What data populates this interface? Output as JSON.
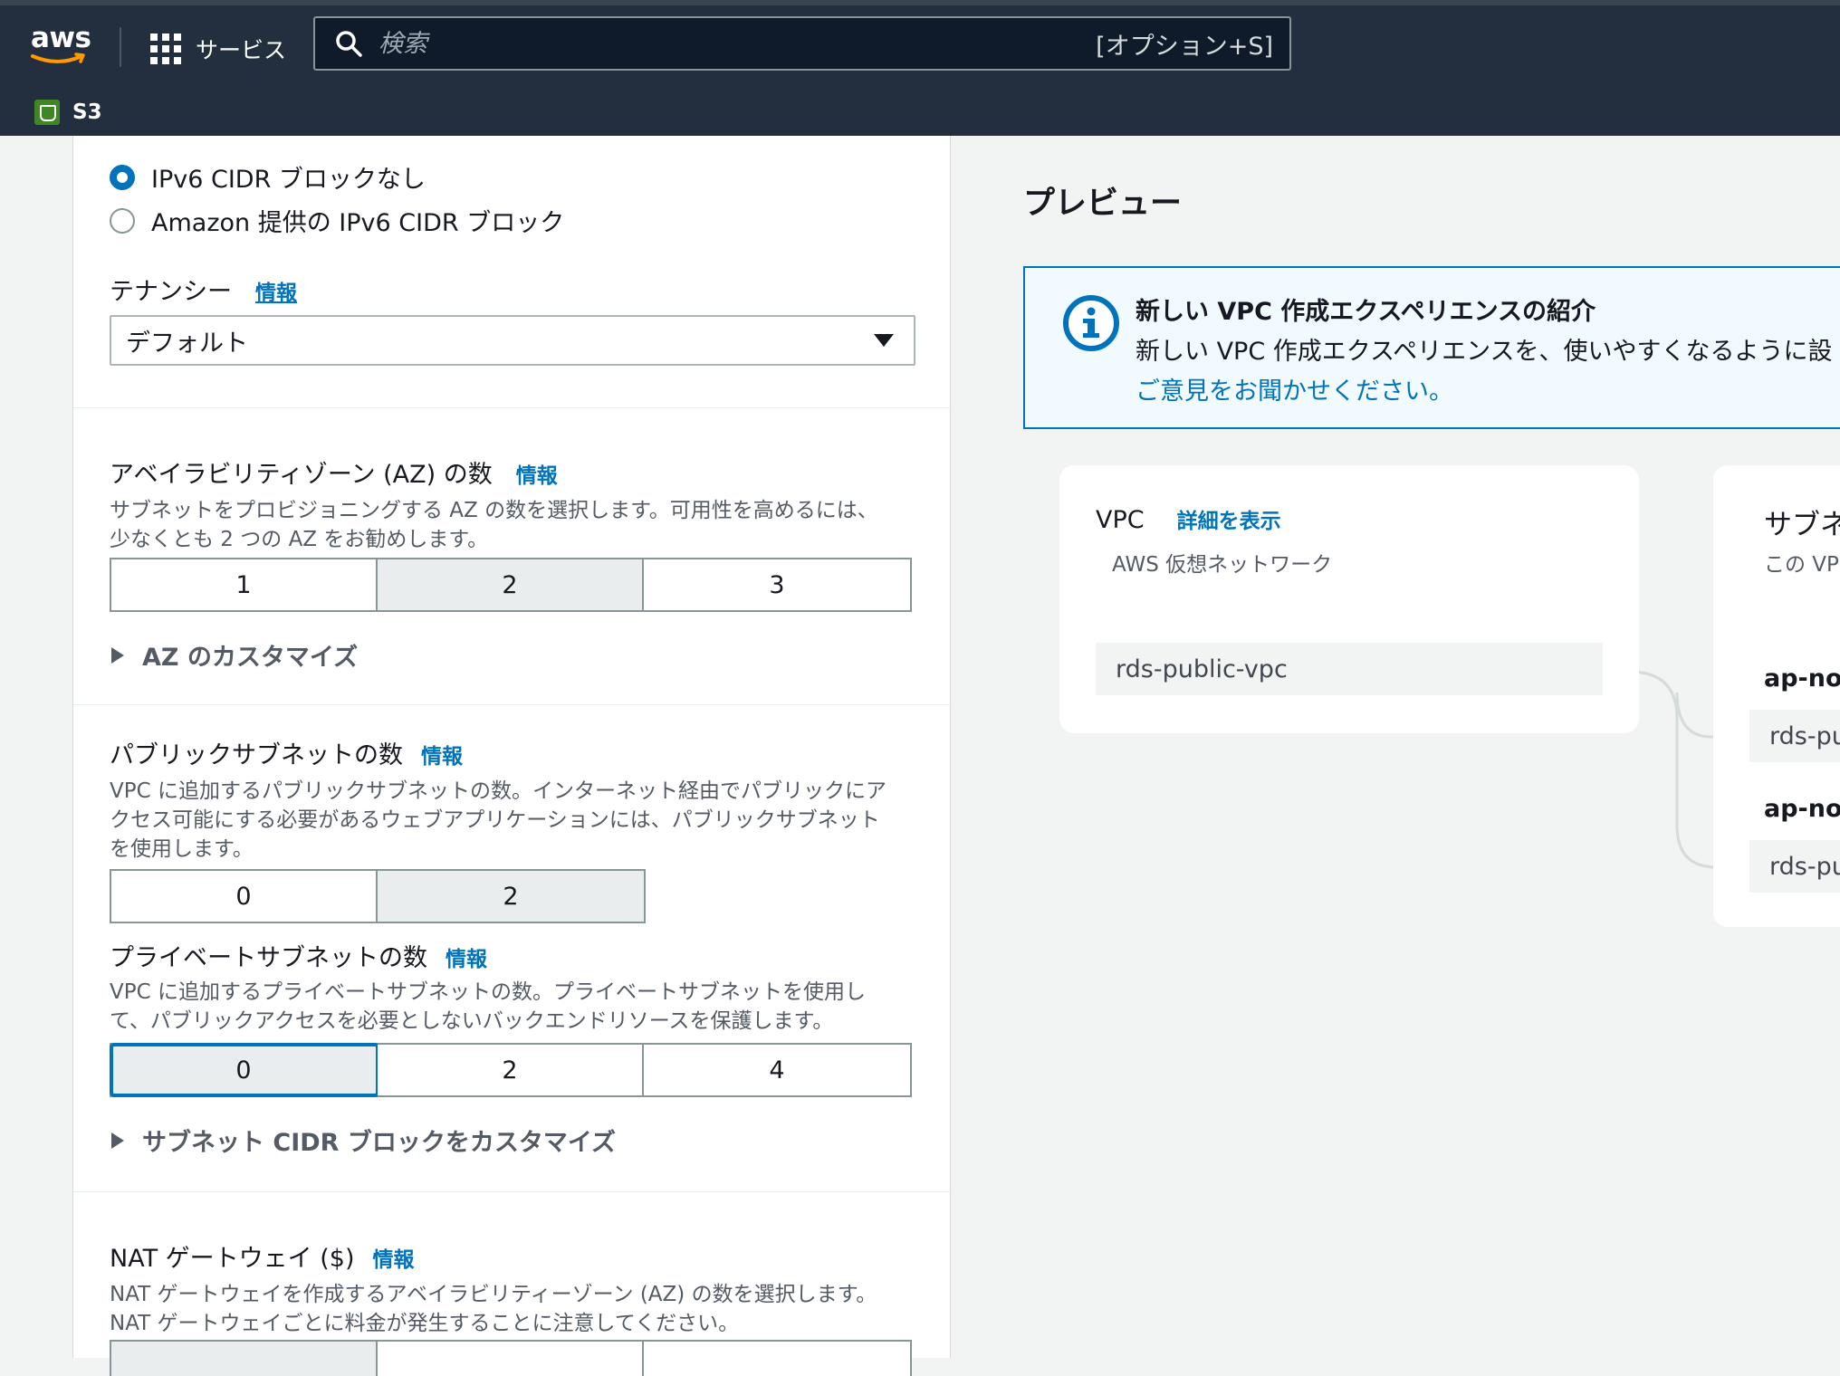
{
  "nav": {
    "logo_text": "aws",
    "services_label": "サービス",
    "search_placeholder": "検索",
    "search_shortcut": "[オプション+S]",
    "service_name": "S3"
  },
  "form": {
    "ipv6_radio_none": "IPv6 CIDR ブロックなし",
    "ipv6_radio_amazon": "Amazon 提供の IPv6 CIDR ブロック",
    "tenancy_label": "テナンシー",
    "info": "情報",
    "tenancy_value": "デフォルト",
    "az": {
      "label": "アベイラビリティゾーン (AZ) の数",
      "desc_1": "サブネットをプロビジョニングする AZ の数を選択します。可用性を高めるには、",
      "desc_2": "少なくとも 2 つの AZ をお勧めします。",
      "options": [
        "1",
        "2",
        "3"
      ],
      "selected": "2",
      "customize": "AZ のカスタマイズ"
    },
    "public": {
      "label": "パブリックサブネットの数",
      "desc_1": "VPC に追加するパブリックサブネットの数。インターネット経由でパブリックにア",
      "desc_2": "クセス可能にする必要があるウェブアプリケーションには、パブリックサブネット",
      "desc_3": "を使用します。",
      "options": [
        "0",
        "2"
      ],
      "selected": "2"
    },
    "private": {
      "label": "プライベートサブネットの数",
      "desc_1": "VPC に追加するプライベートサブネットの数。プライベートサブネットを使用し",
      "desc_2": "て、パブリックアクセスを必要としないバックエンドリソースを保護します。",
      "options": [
        "0",
        "2",
        "4"
      ],
      "selected": "0",
      "customize": "サブネット CIDR ブロックをカスタマイズ"
    },
    "nat": {
      "label": "NAT ゲートウェイ ($)",
      "desc_1": "NAT ゲートウェイを作成するアベイラビリティーゾーン (AZ) の数を選択します。",
      "desc_2": "NAT ゲートウェイごとに料金が発生することに注意してください。"
    }
  },
  "preview": {
    "title": "プレビュー",
    "flash": {
      "heading": "新しい VPC 作成エクスペリエンスの紹介",
      "body": "新しい VPC 作成エクスペリエンスを、使いやすくなるように設",
      "link": "ご意見をお聞かせください。"
    },
    "vpc": {
      "title": "VPC",
      "details_link": "詳細を表示",
      "subtitle": "AWS 仮想ネットワーク",
      "name": "rds-public-vpc"
    },
    "subnets": {
      "title": "サブネ",
      "subtitle": "この VP",
      "az1": "ap-nor",
      "subnet1": "rds-pu",
      "az2": "ap-nor",
      "subnet2": "rds-pu"
    }
  },
  "colors": {
    "nav_bg": "#232f3e",
    "accent": "#0073bb",
    "selected_bg": "#eaeded",
    "page_bg": "#f2f3f3"
  }
}
